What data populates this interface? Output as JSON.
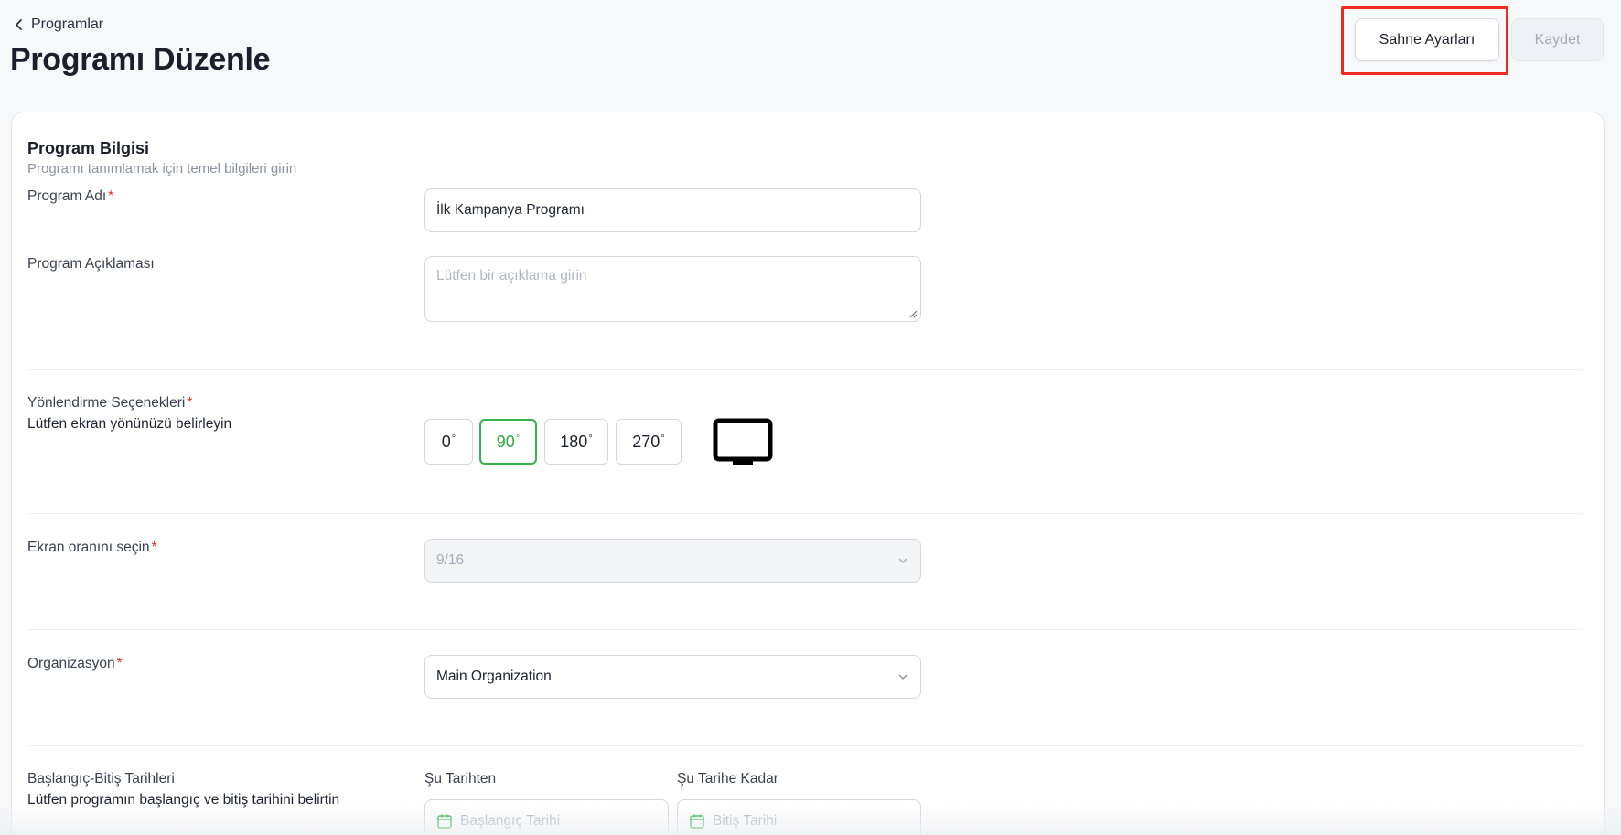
{
  "header": {
    "back_label": "Programlar",
    "title": "Programı Düzenle",
    "scene_settings_label": "Sahne Ayarları",
    "save_label": "Kaydet"
  },
  "section": {
    "title": "Program Bilgisi",
    "subtitle": "Programı tanımlamak için temel bilgileri girin"
  },
  "fields": {
    "program_name": {
      "label": "Program Adı",
      "required_mark": "*",
      "value": "İlk Kampanya Programı"
    },
    "program_description": {
      "label": "Program Açıklaması",
      "placeholder": "Lütfen bir açıklama girin"
    },
    "orientation": {
      "label": "Yönlendirme Seçenekleri",
      "required_mark": "*",
      "sublabel": "Lütfen ekran yönünüzü belirleyin",
      "options": [
        "0",
        "90",
        "180",
        "270"
      ],
      "degree_symbol": "°",
      "selected": "90"
    },
    "aspect_ratio": {
      "label": "Ekran oranını seçin",
      "required_mark": "*",
      "value": "9/16",
      "disabled": true
    },
    "organization": {
      "label": "Organizasyon",
      "required_mark": "*",
      "value": "Main Organization"
    },
    "dates": {
      "label": "Başlangıç-Bitiş Tarihleri",
      "sublabel": "Lütfen programın başlangıç ve bitiş tarihini belirtin",
      "from_label": "Şu Tarihten",
      "to_label": "Şu Tarihe Kadar",
      "start_placeholder": "Başlangıç Tarihi",
      "end_placeholder": "Bitiş Tarihi"
    }
  },
  "colors": {
    "accent_green": "#35b24a",
    "required_red": "#e0312b",
    "highlight_red": "#ee2b20"
  }
}
